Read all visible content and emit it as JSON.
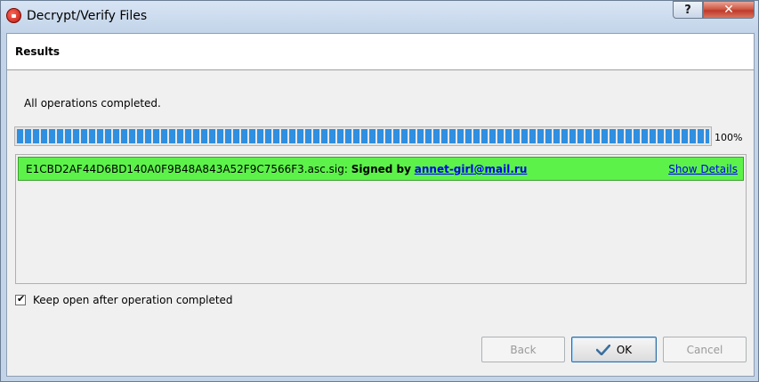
{
  "window": {
    "title": "Decrypt/Verify Files",
    "help_label": "?",
    "close_label": "✕"
  },
  "header": {
    "title": "Results"
  },
  "status": {
    "text": "All operations completed."
  },
  "progress": {
    "value": 1.0,
    "label": "100%"
  },
  "result": {
    "filename": "E1CBD2AF44D6BD140A0F9B48A843A52F9C7566F3.asc.sig:",
    "signed_label": "Signed by",
    "email": "annet-girl@mail.ru",
    "details_label": "Show Details",
    "status_color": "#5cf24a"
  },
  "options": {
    "keep_open_label": "Keep open after operation completed",
    "keep_open_checked": true
  },
  "buttons": {
    "back_label": "Back",
    "ok_label": "OK",
    "cancel_label": "Cancel"
  },
  "icons": {
    "app": "kleopatra-icon",
    "ok": "checkmark-icon"
  }
}
